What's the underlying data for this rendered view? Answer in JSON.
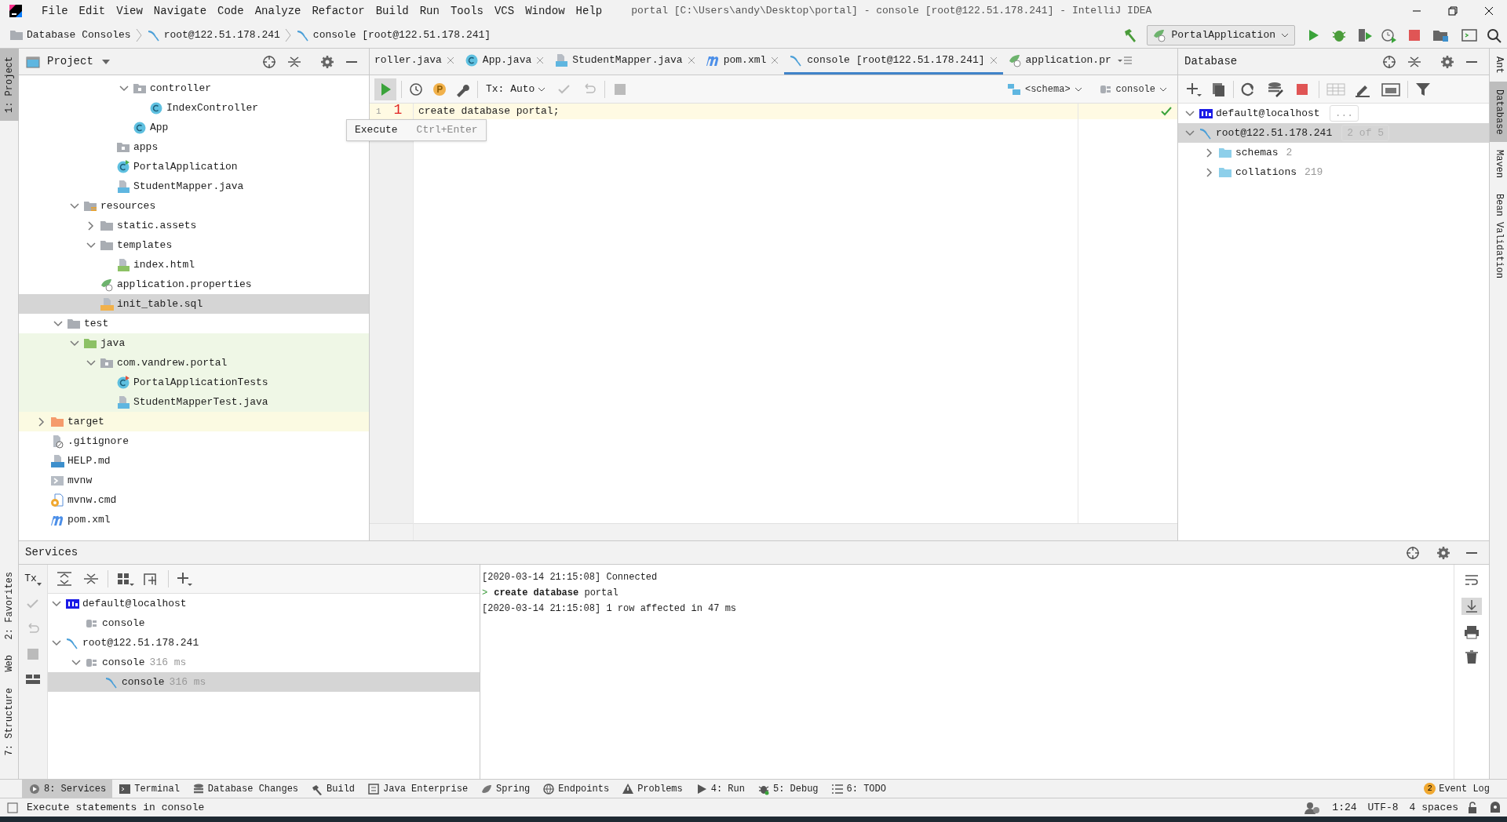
{
  "window": {
    "title": "portal [C:\\Users\\andy\\Desktop\\portal] - console [root@122.51.178.241] - IntelliJ IDEA"
  },
  "menu": [
    "File",
    "Edit",
    "View",
    "Navigate",
    "Code",
    "Analyze",
    "Refactor",
    "Build",
    "Run",
    "Tools",
    "VCS",
    "Window",
    "Help"
  ],
  "breadcrumbs": [
    {
      "label": "Database Consoles",
      "kind": "folder"
    },
    {
      "label": "root@122.51.178.241",
      "kind": "mysql"
    },
    {
      "label": "console [root@122.51.178.241]",
      "kind": "mysql"
    }
  ],
  "run_config": "PortalApplication",
  "left_strip": [
    {
      "label": "1: Project",
      "selected": true
    },
    {
      "label": "2: Favorites",
      "selected": false
    },
    {
      "label": "Web",
      "selected": false
    },
    {
      "label": "7: Structure",
      "selected": false
    }
  ],
  "right_strip": [
    {
      "label": "Ant",
      "selected": false
    },
    {
      "label": "Database",
      "selected": true
    },
    {
      "label": "Maven",
      "selected": false
    },
    {
      "label": "Bean Validation",
      "selected": false
    }
  ],
  "project": {
    "title": "Project",
    "tree": [
      {
        "children": [
          {
            "children": [
              {
                "children": [
                  {
                    "children": [
                      {
                        "children": [
                          {
                            "label": "controller",
                            "kind": "package",
                            "expanded": true,
                            "children": [
                              {
                                "label": "IndexController",
                                "kind": "class"
                              }
                            ]
                          },
                          {
                            "label": "App",
                            "kind": "class"
                          }
                        ]
                      },
                      {
                        "label": "apps",
                        "kind": "package"
                      },
                      {
                        "label": "PortalApplication",
                        "kind": "springclass"
                      },
                      {
                        "label": "StudentMapper.java",
                        "kind": "javafile"
                      }
                    ]
                  }
                ]
              },
              {
                "label": "resources",
                "kind": "resfolder",
                "expanded": true,
                "children": [
                  {
                    "label": "static.assets",
                    "kind": "folder",
                    "expanded": false
                  },
                  {
                    "label": "templates",
                    "kind": "folder",
                    "expanded": true,
                    "children": [
                      {
                        "label": "index.html",
                        "kind": "html"
                      }
                    ]
                  },
                  {
                    "label": "application.properties",
                    "kind": "props"
                  },
                  {
                    "label": "init_table.sql",
                    "kind": "sql",
                    "selected": true
                  }
                ]
              }
            ]
          },
          {
            "label": "test",
            "kind": "folder",
            "expanded": true,
            "children": [
              {
                "label": "java",
                "kind": "testfolder",
                "test_source": true,
                "expanded": true,
                "children": [
                  {
                    "label": "com.vandrew.portal",
                    "kind": "package",
                    "test_source": true,
                    "expanded": true,
                    "children": [
                      {
                        "label": "PortalApplicationTests",
                        "kind": "testclass",
                        "test_source": true
                      },
                      {
                        "label": "StudentMapperTest.java",
                        "kind": "javafile",
                        "test_source": true
                      }
                    ]
                  }
                ]
              }
            ]
          }
        ]
      },
      {
        "label": "target",
        "kind": "excluded",
        "excluded": true,
        "expanded": false
      },
      {
        "label": ".gitignore",
        "kind": "ignore"
      },
      {
        "label": "HELP.md",
        "kind": "md"
      },
      {
        "label": "mvnw",
        "kind": "script"
      },
      {
        "label": "mvnw.cmd",
        "kind": "cmd"
      },
      {
        "label": "pom.xml",
        "kind": "pom"
      }
    ]
  },
  "editor": {
    "tabs": [
      {
        "label": "roller.java",
        "selected": false
      },
      {
        "label": "App.java",
        "kind": "class",
        "selected": false
      },
      {
        "label": "StudentMapper.java",
        "kind": "javafile",
        "selected": false
      },
      {
        "label": "pom.xml",
        "kind": "pom",
        "selected": false
      },
      {
        "label": "console [root@122.51.178.241]",
        "kind": "mysql",
        "selected": true
      },
      {
        "label": "application.pr",
        "kind": "props",
        "selected": false
      }
    ],
    "tx": "Tx: Auto",
    "schema": "<schema>",
    "session": "console",
    "lines": [
      {
        "number": "1",
        "text": "create database portal;"
      }
    ],
    "marker": "1",
    "tooltip": {
      "action": "Execute",
      "shortcut": "Ctrl+Enter"
    }
  },
  "database": {
    "title": "Database",
    "tree": [
      {
        "label": "default@localhost",
        "kind": "h2",
        "badge": "...",
        "expanded": true
      },
      {
        "label": "root@122.51.178.241",
        "kind": "mysql",
        "badge": "2 of 5",
        "selected": true,
        "expanded": true,
        "children": [
          {
            "label": "schemas",
            "kind": "dbfolder",
            "count": "2",
            "expanded": false
          },
          {
            "label": "collations",
            "kind": "dbfolder",
            "count": "219",
            "expanded": false
          }
        ]
      }
    ]
  },
  "services": {
    "title": "Services",
    "tx": "Tx",
    "tree": [
      {
        "label": "default@localhost",
        "kind": "h2",
        "expanded": true,
        "children": [
          {
            "label": "console",
            "kind": "session"
          }
        ]
      },
      {
        "label": "root@122.51.178.241",
        "kind": "mysql",
        "expanded": true,
        "children": [
          {
            "label": "console",
            "kind": "session",
            "time": "316 ms",
            "expanded": true,
            "children": [
              {
                "label": "console",
                "kind": "mysql",
                "time": "316 ms",
                "selected": true
              }
            ]
          }
        ]
      }
    ],
    "output": [
      {
        "kind": "log",
        "text": "[2020-03-14 21:15:08] Connected"
      },
      {
        "kind": "command",
        "prompt": ">",
        "text": "**create database** portal"
      },
      {
        "kind": "log",
        "text": "[2020-03-14 21:15:08] 1 row affected in 47 ms"
      }
    ]
  },
  "tool_tabs": [
    {
      "label": "8: Services",
      "kind": "services",
      "selected": true
    },
    {
      "label": "Terminal",
      "kind": "terminal",
      "selected": false
    },
    {
      "label": "Database Changes",
      "kind": "dbchanges",
      "selected": false
    },
    {
      "label": "Build",
      "kind": "build",
      "selected": false
    },
    {
      "label": "Java Enterprise",
      "kind": "jee",
      "selected": false
    },
    {
      "label": "Spring",
      "kind": "spring",
      "selected": false
    },
    {
      "label": "Endpoints",
      "kind": "endpoints",
      "selected": false
    },
    {
      "label": "Problems",
      "kind": "problems",
      "selected": false
    },
    {
      "label": "4: Run",
      "kind": "run",
      "selected": false
    },
    {
      "label": "5: Debug",
      "kind": "debug",
      "selected": false
    },
    {
      "label": "6: TODO",
      "kind": "todo",
      "selected": false
    }
  ],
  "event_log": {
    "label": "Event Log",
    "count": "2"
  },
  "status_bar": {
    "message": "Execute statements in console",
    "position": "1:24",
    "encoding": "UTF-8",
    "indent": "4 spaces"
  }
}
